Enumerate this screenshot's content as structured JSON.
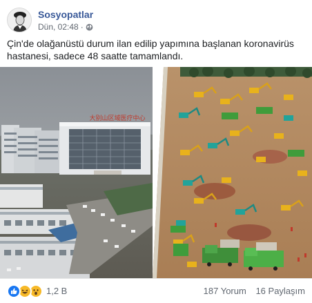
{
  "post": {
    "page_name": "Sosyopatlar",
    "timestamp": "Dün, 02:48",
    "separator": "·",
    "privacy_icon": "globe-icon",
    "text": "Çin'de olağanüstü durum ilan edilip yapımına başlanan koronavirüs hastanesi, sadece 48 saatte tamamlandı.",
    "image": {
      "left_caption": "A completed hospital building with a red roof sign",
      "sign_text": "大别山区域医疗中心"
    }
  },
  "footer": {
    "reaction_icons": [
      "like-icon",
      "haha-icon",
      "wow-icon"
    ],
    "reaction_count": "1,2 B",
    "comments": "187 Yorum",
    "shares": "16 Paylaşım"
  },
  "colors": {
    "link": "#385898",
    "meta": "#616770",
    "like": "#1877f2",
    "emoji": "#f7b928"
  }
}
